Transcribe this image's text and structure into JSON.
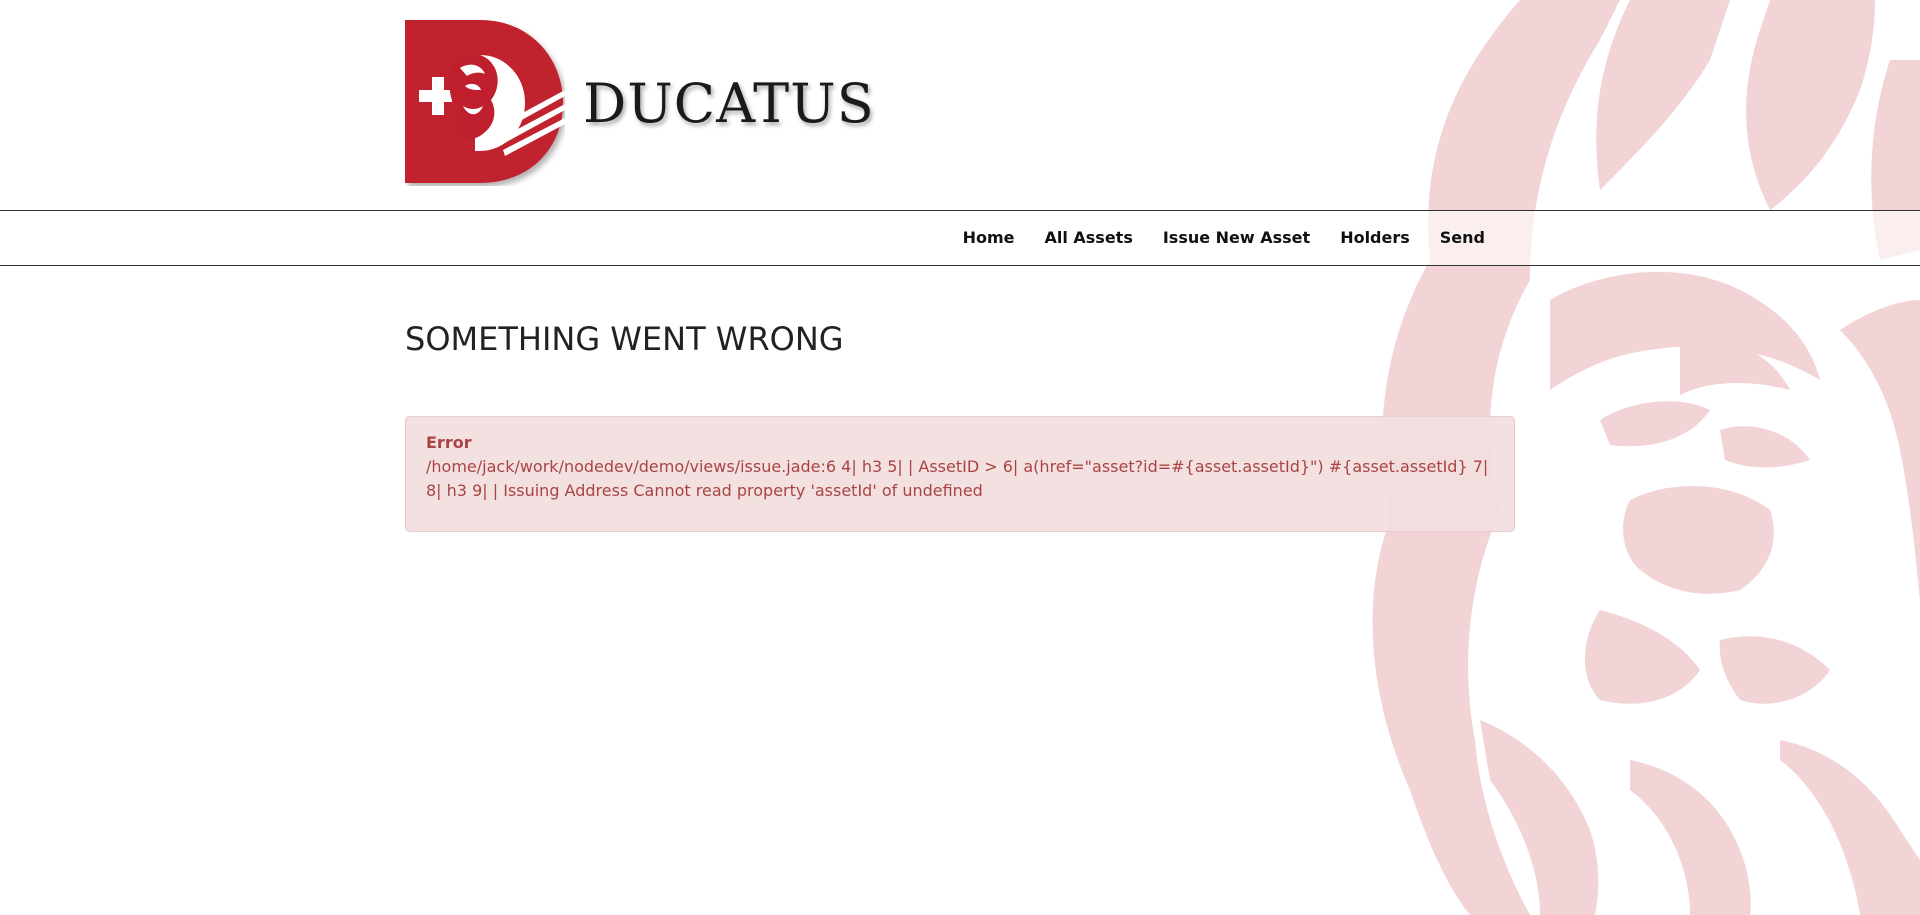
{
  "brand": {
    "name": "DUCATUS",
    "colors": {
      "primary_red": "#c0202e",
      "watermark": "#f2d4d6"
    },
    "logo_icon": "ducatus-lion-d-logo"
  },
  "nav": {
    "items": [
      {
        "label": "Home"
      },
      {
        "label": "All Assets"
      },
      {
        "label": "Issue New Asset"
      },
      {
        "label": "Holders"
      },
      {
        "label": "Send"
      }
    ]
  },
  "main": {
    "title": "SOMETHING WENT WRONG",
    "error": {
      "title": "Error",
      "message": "/home/jack/work/nodedev/demo/views/issue.jade:6 4| h3 5| | AssetID > 6| a(href=\"asset?id=#{asset.assetId}\") #{asset.assetId} 7| 8| h3 9| | Issuing Address Cannot read property 'assetId' of undefined",
      "color": "#a94442",
      "background": "#f2dede"
    }
  },
  "decor": {
    "background_icon": "lion-watermark-icon"
  }
}
